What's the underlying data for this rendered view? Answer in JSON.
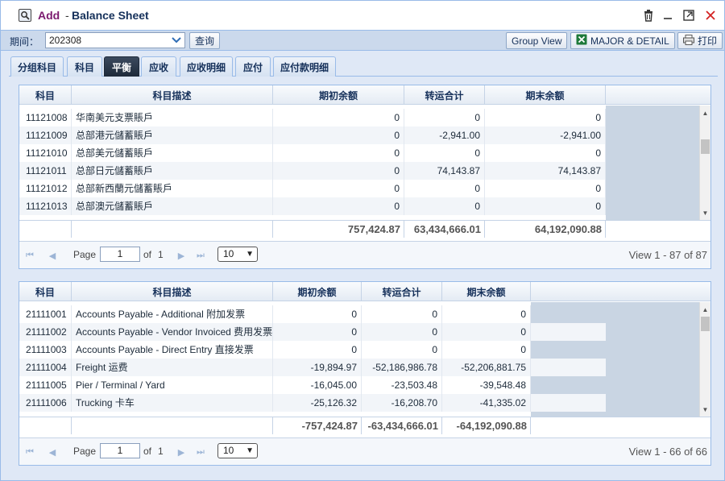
{
  "window": {
    "mode": "Add",
    "separator": "-",
    "title": "Balance Sheet"
  },
  "toolbar": {
    "period_label": "期间：",
    "period_value": "202308",
    "query_label": "查询",
    "group_view_label": "Group View",
    "major_detail_label": "MAJOR & DETAIL",
    "print_label": "打印"
  },
  "tabs": [
    {
      "label": "分组科目",
      "active": false
    },
    {
      "label": "科目",
      "active": false
    },
    {
      "label": "平衡",
      "active": true
    },
    {
      "label": "应收",
      "active": false
    },
    {
      "label": "应收明细",
      "active": false
    },
    {
      "label": "应付",
      "active": false
    },
    {
      "label": "应付款明细",
      "active": false
    }
  ],
  "grid1": {
    "columns": [
      "科目",
      "科目描述",
      "期初余额",
      "转运合计",
      "期末余额"
    ],
    "rows": [
      {
        "code": "11121008",
        "desc": "华南美元支票賬戶",
        "open": "0",
        "transfer": "0",
        "close": "0"
      },
      {
        "code": "11121009",
        "desc": "总部港元儲蓄賬戶",
        "open": "0",
        "transfer": "-2,941.00",
        "close": "-2,941.00"
      },
      {
        "code": "11121010",
        "desc": "总部美元儲蓄賬戶",
        "open": "0",
        "transfer": "0",
        "close": "0"
      },
      {
        "code": "11121011",
        "desc": "总部日元儲蓄賬戶",
        "open": "0",
        "transfer": "74,143.87",
        "close": "74,143.87"
      },
      {
        "code": "11121012",
        "desc": "总部新西蘭元儲蓄賬戶",
        "open": "0",
        "transfer": "0",
        "close": "0"
      },
      {
        "code": "11121013",
        "desc": "总部澳元儲蓄賬戶",
        "open": "0",
        "transfer": "0",
        "close": "0"
      }
    ],
    "totals": {
      "open": "757,424.87",
      "transfer": "63,434,666.01",
      "close": "64,192,090.88"
    },
    "pager": {
      "page_label": "Page",
      "page": "1",
      "of_label": "of",
      "pages": "1",
      "page_size": "10",
      "info": "View 1 - 87 of 87"
    }
  },
  "grid2": {
    "columns": [
      "科目",
      "科目描述",
      "期初余额",
      "转运合计",
      "期末余额"
    ],
    "rows": [
      {
        "code": "21111001",
        "desc": "Accounts Payable - Additional 附加发票",
        "open": "0",
        "transfer": "0",
        "close": "0"
      },
      {
        "code": "21111002",
        "desc": "Accounts Payable - Vendor Invoiced 费用发票",
        "open": "0",
        "transfer": "0",
        "close": "0"
      },
      {
        "code": "21111003",
        "desc": "Accounts Payable - Direct Entry 直接发票",
        "open": "0",
        "transfer": "0",
        "close": "0"
      },
      {
        "code": "21111004",
        "desc": "Freight 运费",
        "open": "-19,894.97",
        "transfer": "-52,186,986.78",
        "close": "-52,206,881.75"
      },
      {
        "code": "21111005",
        "desc": "Pier / Terminal / Yard",
        "open": "-16,045.00",
        "transfer": "-23,503.48",
        "close": "-39,548.48"
      },
      {
        "code": "21111006",
        "desc": "Trucking 卡车",
        "open": "-25,126.32",
        "transfer": "-16,208.70",
        "close": "-41,335.02"
      }
    ],
    "totals": {
      "open": "-757,424.87",
      "transfer": "-63,434,666.01",
      "close": "-64,192,090.88"
    },
    "pager": {
      "page_label": "Page",
      "page": "1",
      "of_label": "of",
      "pages": "1",
      "page_size": "10",
      "info": "View 1 - 66 of 66"
    }
  }
}
